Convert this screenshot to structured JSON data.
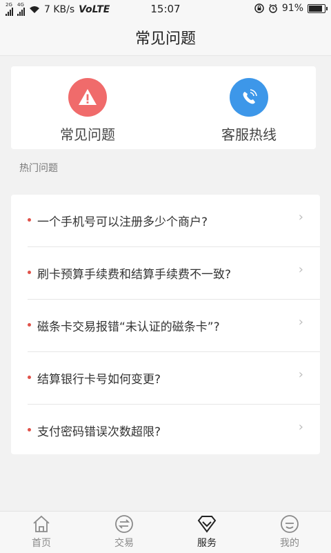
{
  "status_bar": {
    "network_type": "4G",
    "secondary_network": "2G",
    "speed": "7 KB/s",
    "volte": "VoLTE",
    "time": "15:07",
    "battery": "91%",
    "battery_level": 0.91
  },
  "header": {
    "title": "常见问题"
  },
  "quick_actions": [
    {
      "label": "常见问题",
      "icon": "warning-icon",
      "color": "#f06b6b"
    },
    {
      "label": "客服热线",
      "icon": "phone-icon",
      "color": "#3d97e9"
    }
  ],
  "section_title": "热门问题",
  "faq": [
    {
      "text": "一个手机号可以注册多少个商户?"
    },
    {
      "text": "刷卡预算手续费和结算手续费不一致?"
    },
    {
      "text": "磁条卡交易报错“未认证的磁条卡”?"
    },
    {
      "text": "结算银行卡号如何变更?"
    },
    {
      "text": "支付密码错误次数超限?"
    }
  ],
  "tabs": [
    {
      "label": "首页",
      "icon": "home-icon",
      "active": false
    },
    {
      "label": "交易",
      "icon": "transfer-icon",
      "active": false
    },
    {
      "label": "服务",
      "icon": "diamond-icon",
      "active": true
    },
    {
      "label": "我的",
      "icon": "smiley-icon",
      "active": false
    }
  ],
  "colors": {
    "accent_red": "#f06b6b",
    "accent_blue": "#3d97e9",
    "dot_red": "#e0524a"
  }
}
